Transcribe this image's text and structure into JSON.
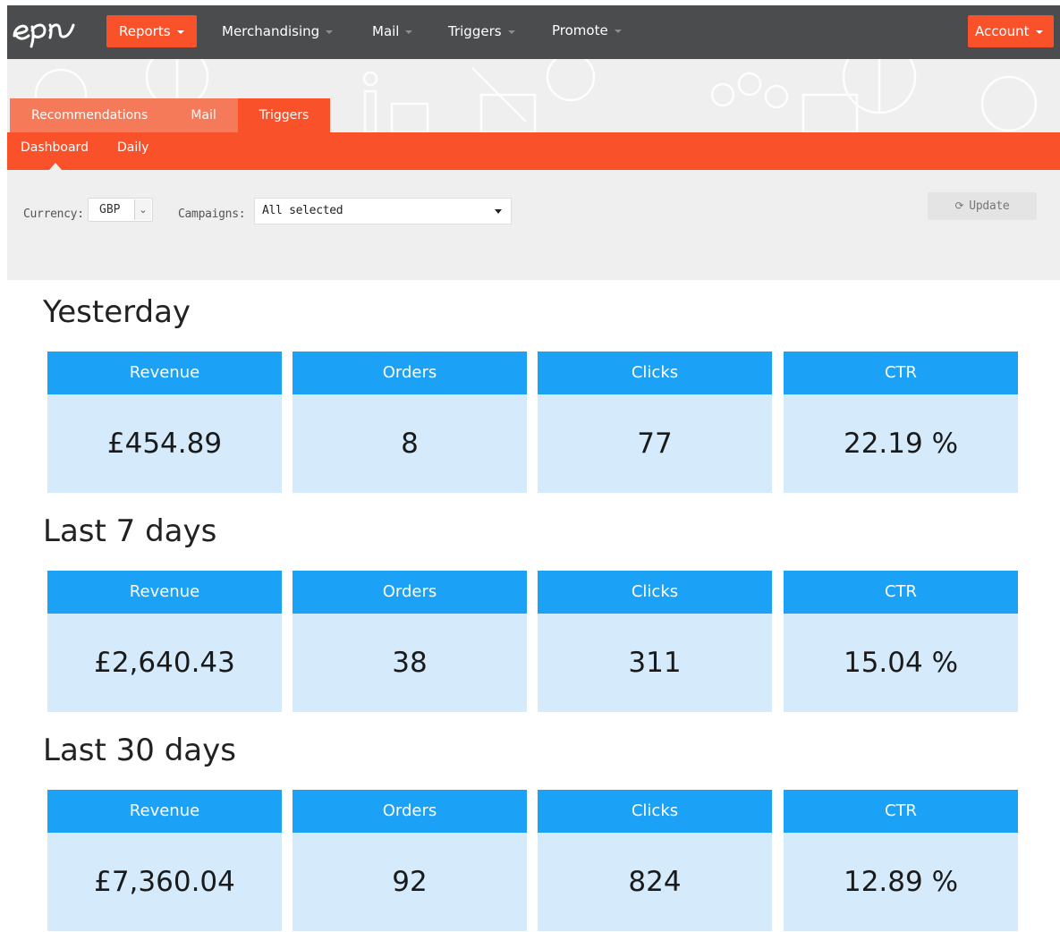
{
  "topnav": {
    "items": [
      {
        "label": "Reports",
        "active": true
      },
      {
        "label": "Merchandising"
      },
      {
        "label": "Mail"
      },
      {
        "label": "Triggers"
      },
      {
        "label": "Promote"
      }
    ],
    "account_label": "Account",
    "logo_text": "epi"
  },
  "tabs": [
    {
      "label": "Recommendations"
    },
    {
      "label": "Mail"
    },
    {
      "label": "Triggers",
      "active": true
    }
  ],
  "subtabs": [
    {
      "label": "Dashboard",
      "active": true
    },
    {
      "label": "Daily"
    }
  ],
  "filters": {
    "currency_label": "Currency:",
    "currency_value": "GBP",
    "campaigns_label": "Campaigns:",
    "campaigns_value": "All selected",
    "update_label": "Update"
  },
  "sections": [
    {
      "title": "Yesterday",
      "metrics": [
        {
          "label": "Revenue",
          "value": "£454.89"
        },
        {
          "label": "Orders",
          "value": "8"
        },
        {
          "label": "Clicks",
          "value": "77"
        },
        {
          "label": "CTR",
          "value": "22.19 %"
        }
      ]
    },
    {
      "title": "Last 7 days",
      "metrics": [
        {
          "label": "Revenue",
          "value": "£2,640.43"
        },
        {
          "label": "Orders",
          "value": "38"
        },
        {
          "label": "Clicks",
          "value": "311"
        },
        {
          "label": "CTR",
          "value": "15.04 %"
        }
      ]
    },
    {
      "title": "Last 30 days",
      "metrics": [
        {
          "label": "Revenue",
          "value": "£7,360.04"
        },
        {
          "label": "Orders",
          "value": "92"
        },
        {
          "label": "Clicks",
          "value": "824"
        },
        {
          "label": "CTR",
          "value": "12.89 %"
        }
      ]
    }
  ],
  "colors": {
    "nav_bg": "#4b4c4d",
    "accent_orange": "#f9522b",
    "card_header_blue": "#1ba1f5",
    "card_body_blue": "#d5ebfb"
  }
}
